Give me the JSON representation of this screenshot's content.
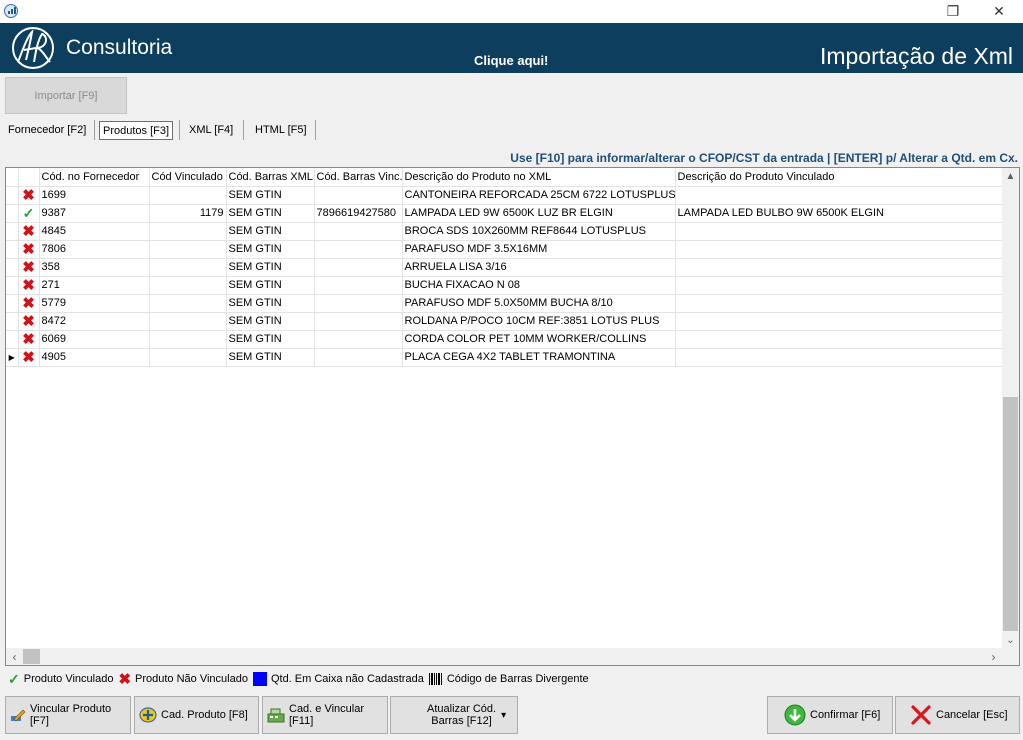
{
  "window": {
    "restore_glyph": "❐",
    "close_glyph": "✕"
  },
  "header": {
    "logo_text": "Consultoria",
    "click_here": "Clique aqui!",
    "title": "Importação de Xml"
  },
  "toolbar": {
    "import_label": "Importar [F9]"
  },
  "tabs": [
    {
      "label": "Fornecedor [F2]",
      "active": false
    },
    {
      "label": "Produtos [F3]",
      "active": true
    },
    {
      "label": "XML [F4]",
      "active": false
    },
    {
      "label": "HTML [F5]",
      "active": false
    }
  ],
  "hint": "Use [F10] para informar/alterar o CFOP/CST da entrada | [ENTER] p/ Alterar a Qtd. em Cx.",
  "grid": {
    "columns": [
      "",
      "",
      "Cód. no Fornecedor",
      "Cód Vinculado",
      "Cód. Barras XML",
      "Cód. Barras Vinc.",
      "Descrição do Produto no XML",
      "Descrição do Produto Vinculado"
    ],
    "rows": [
      {
        "status": "x",
        "cod_forn": "1699",
        "cod_vinc": "",
        "barras_xml": "SEM GTIN",
        "barras_vinc": "",
        "desc_xml": "CANTONEIRA REFORCADA 25CM 6722 LOTUSPLUS",
        "desc_vinc": ""
      },
      {
        "status": "ok",
        "cod_forn": "9387",
        "cod_vinc": "1179",
        "barras_xml": "SEM GTIN",
        "barras_vinc": "7896619427580",
        "desc_xml": "LAMPADA LED 9W 6500K LUZ BR ELGIN",
        "desc_vinc": "LAMPADA LED BULBO 9W 6500K ELGIN"
      },
      {
        "status": "x",
        "cod_forn": "4845",
        "cod_vinc": "",
        "barras_xml": "SEM GTIN",
        "barras_vinc": "",
        "desc_xml": "BROCA SDS 10X260MM REF8644 LOTUSPLUS",
        "desc_vinc": ""
      },
      {
        "status": "x",
        "cod_forn": "7806",
        "cod_vinc": "",
        "barras_xml": "SEM GTIN",
        "barras_vinc": "",
        "desc_xml": "PARAFUSO MDF 3.5X16MM",
        "desc_vinc": ""
      },
      {
        "status": "x",
        "cod_forn": "358",
        "cod_vinc": "",
        "barras_xml": "SEM GTIN",
        "barras_vinc": "",
        "desc_xml": "ARRUELA LISA 3/16",
        "desc_vinc": ""
      },
      {
        "status": "x",
        "cod_forn": "271",
        "cod_vinc": "",
        "barras_xml": "SEM GTIN",
        "barras_vinc": "",
        "desc_xml": "BUCHA FIXACAO N 08",
        "desc_vinc": ""
      },
      {
        "status": "x",
        "cod_forn": "5779",
        "cod_vinc": "",
        "barras_xml": "SEM GTIN",
        "barras_vinc": "",
        "desc_xml": "PARAFUSO MDF 5.0X50MM BUCHA 8/10",
        "desc_vinc": ""
      },
      {
        "status": "x",
        "cod_forn": "8472",
        "cod_vinc": "",
        "barras_xml": "SEM GTIN",
        "barras_vinc": "",
        "desc_xml": "ROLDANA P/POCO 10CM REF:3851 LOTUS PLUS",
        "desc_vinc": ""
      },
      {
        "status": "x",
        "cod_forn": "6069",
        "cod_vinc": "",
        "barras_xml": "SEM GTIN",
        "barras_vinc": "",
        "desc_xml": "CORDA COLOR PET 10MM WORKER/COLLINS",
        "desc_vinc": ""
      },
      {
        "status": "x",
        "cod_forn": "4905",
        "cod_vinc": "",
        "barras_xml": "SEM GTIN",
        "barras_vinc": "",
        "desc_xml": "PLACA CEGA 4X2 TABLET TRAMONTINA",
        "desc_vinc": "",
        "current": true
      }
    ]
  },
  "legend": {
    "vinculado": "Produto Vinculado",
    "nao_vinculado": "Produto Não Vinculado",
    "qtd_caixa": "Qtd. Em Caixa não Cadastrada",
    "barras_divergente": "Código de Barras Divergente"
  },
  "buttons": {
    "vincular": "Vincular Produto [F7]",
    "cad_produto": "Cad. Produto [F8]",
    "cad_vincular": "Cad. e Vincular [F11]",
    "atualizar_line1": "Atualizar Cód.",
    "atualizar_line2": "Barras [F12]",
    "confirmar": "Confirmar [F6]",
    "cancelar": "Cancelar [Esc]"
  },
  "colors": {
    "header_bg": "#0d3e5e",
    "ok_green": "#22a52a",
    "error_red": "#d0121b",
    "legend_blue": "#0000ff",
    "hint_text": "#1f4e79"
  },
  "icons": {
    "status_ok": "check-icon",
    "status_x": "x-icon",
    "scroll_up": "▲",
    "scroll_down": "⌄",
    "scroll_left": "‹",
    "scroll_right": "›",
    "current_row": "▶",
    "dropdown": "▾"
  }
}
